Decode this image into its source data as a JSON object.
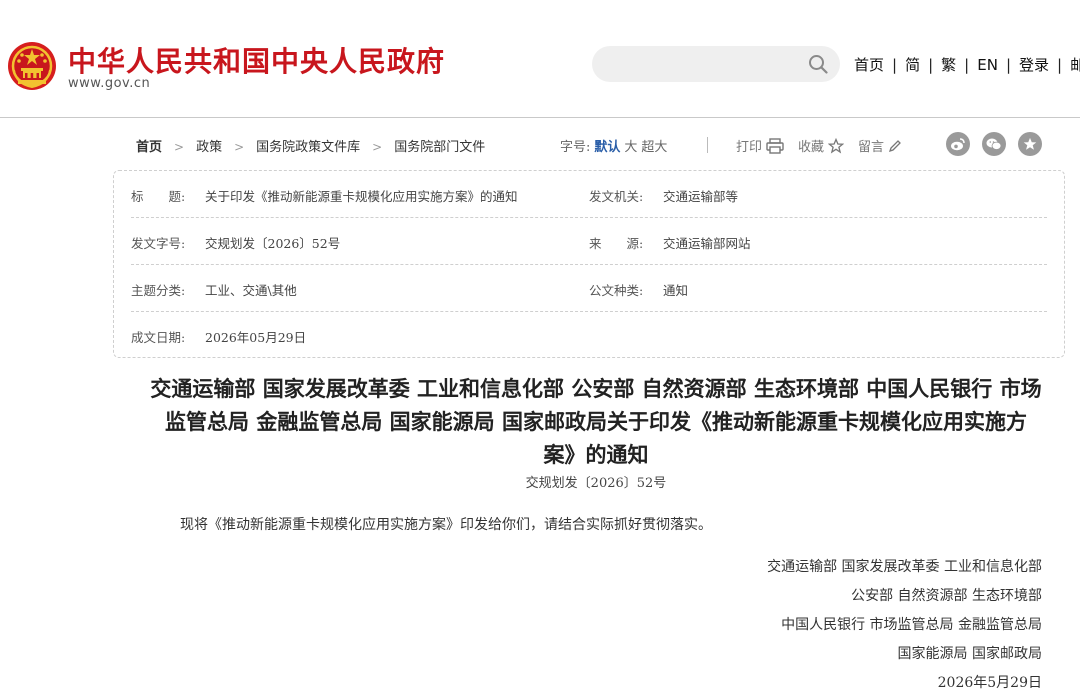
{
  "header": {
    "site_name": "中华人民共和国中央人民政府",
    "site_url": "www.gov.cn",
    "search": {
      "placeholder": "",
      "value": ""
    },
    "nav": [
      "首页",
      "简",
      "繁",
      "EN",
      "登录",
      "邮"
    ],
    "brand_color": "#c8161d"
  },
  "toolbar": {
    "breadcrumb": [
      "首页",
      "政策",
      "国务院政策文件库",
      "国务院部门文件"
    ],
    "font_size_label": "字号:",
    "font_size_options": [
      "默认",
      "大",
      "超大"
    ],
    "active_font_size": "默认",
    "print_label": "打印",
    "favorite_label": "收藏",
    "comment_label": "留言",
    "share_icons": [
      "weibo-icon",
      "wechat-icon",
      "star-icon"
    ]
  },
  "meta": {
    "title_label": "标　　题:",
    "title_value": "关于印发《推动新能源重卡规模化应用实施方案》的通知",
    "issuer_label": "发文机关:",
    "issuer_value": "交通运输部等",
    "doc_no_label": "发文字号:",
    "doc_no_value": "交规划发〔2026〕52号",
    "source_label": "来　　源:",
    "source_value": "交通运输部网站",
    "category_label": "主题分类:",
    "category_value": "工业、交通\\其他",
    "type_label": "公文种类:",
    "type_value": "通知",
    "date_label": "成文日期:",
    "date_value": "2026年05月29日"
  },
  "document": {
    "title": "交通运输部 国家发展改革委 工业和信息化部 公安部 自然资源部 生态环境部 中国人民银行 市场监管总局 金融监管总局 国家能源局 国家邮政局关于印发《推动新能源重卡规模化应用实施方案》的通知",
    "number": "交规划发〔2026〕52号",
    "body": "现将《推动新能源重卡规模化应用实施方案》印发给你们，请结合实际抓好贯彻落实。",
    "signatures": [
      "交通运输部 国家发展改革委 工业和信息化部",
      "公安部 自然资源部 生态环境部",
      "中国人民银行 市场监管总局 金融监管总局",
      "国家能源局 国家邮政局"
    ],
    "date": "2026年5月29日"
  }
}
